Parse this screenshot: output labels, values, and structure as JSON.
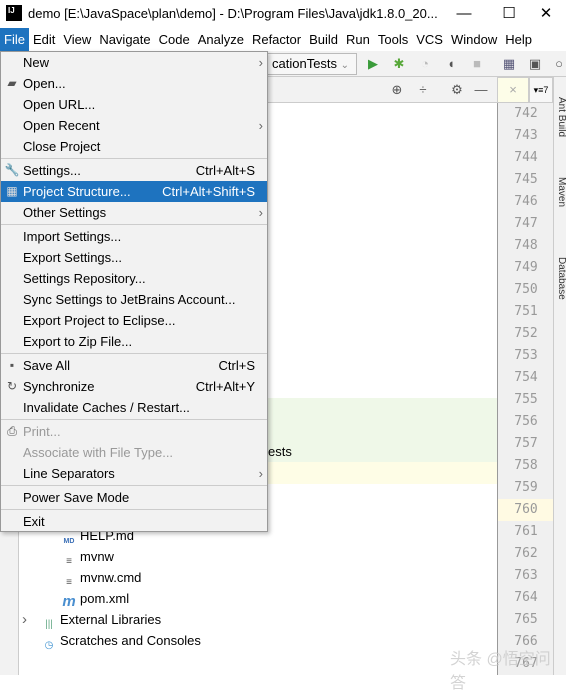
{
  "window": {
    "title": "demo [E:\\JavaSpace\\plan\\demo] - D:\\Program Files\\Java\\jdk1.8.0_20...",
    "logo": "IJ",
    "minimize": "—",
    "maximize": "☐",
    "close": "✕"
  },
  "menubar": [
    "File",
    "Edit",
    "View",
    "Navigate",
    "Code",
    "Analyze",
    "Refactor",
    "Build",
    "Run",
    "Tools",
    "VCS",
    "Window",
    "Help"
  ],
  "toolbar": {
    "run_config": "cationTests",
    "icons": [
      "run-icon",
      "debug-icon",
      "coverage-icon",
      "profile-icon",
      "stop-icon",
      "project-structure-icon",
      "terminal-icon"
    ]
  },
  "editor": {
    "tab_close": "×",
    "structure_tab": "▾≡7",
    "line_numbers": [
      "742",
      "743",
      "744",
      "745",
      "746",
      "747",
      "748",
      "749",
      "750",
      "751",
      "752",
      "753",
      "754",
      "755",
      "756",
      "757",
      "758",
      "759",
      "760",
      "761",
      "762",
      "763",
      "764",
      "765",
      "766",
      "767"
    ],
    "current_line": "760"
  },
  "right_tabs": [
    "Ant Build",
    "Maven",
    "Database"
  ],
  "tree": {
    "partial_text": "ests",
    "items": [
      {
        "label": "HELP.md",
        "icon": "markdown-file-icon"
      },
      {
        "label": "mvnw",
        "icon": "text-file-icon"
      },
      {
        "label": "mvnw.cmd",
        "icon": "text-file-icon"
      },
      {
        "label": "pom.xml",
        "icon": "maven-file-icon"
      },
      {
        "label": "External Libraries",
        "icon": "library-icon"
      },
      {
        "label": "Scratches and Consoles",
        "icon": "scratches-icon"
      }
    ]
  },
  "file_menu": [
    {
      "label": "New",
      "submenu": true
    },
    {
      "label": "Open...",
      "icon": "folder-icon"
    },
    {
      "label": "Open URL..."
    },
    {
      "label": "Open Recent",
      "submenu": true
    },
    {
      "label": "Close Project"
    },
    {
      "sep": true
    },
    {
      "label": "Settings...",
      "shortcut": "Ctrl+Alt+S",
      "icon": "wrench-icon"
    },
    {
      "label": "Project Structure...",
      "shortcut": "Ctrl+Alt+Shift+S",
      "icon": "project-structure-icon",
      "highlighted": true
    },
    {
      "label": "Other Settings",
      "submenu": true
    },
    {
      "sep": true
    },
    {
      "label": "Import Settings..."
    },
    {
      "label": "Export Settings..."
    },
    {
      "label": "Settings Repository..."
    },
    {
      "label": "Sync Settings to JetBrains Account..."
    },
    {
      "label": "Export Project to Eclipse..."
    },
    {
      "label": "Export to Zip File..."
    },
    {
      "sep": true
    },
    {
      "label": "Save All",
      "shortcut": "Ctrl+S",
      "icon": "save-icon"
    },
    {
      "label": "Synchronize",
      "shortcut": "Ctrl+Alt+Y",
      "icon": "sync-icon"
    },
    {
      "label": "Invalidate Caches / Restart..."
    },
    {
      "sep": true
    },
    {
      "label": "Print...",
      "disabled": true,
      "icon": "print-icon"
    },
    {
      "label": "Associate with File Type...",
      "disabled": true
    },
    {
      "label": "Line Separators",
      "submenu": true
    },
    {
      "sep": true
    },
    {
      "label": "Power Save Mode"
    },
    {
      "sep": true
    },
    {
      "label": "Exit"
    }
  ],
  "watermark": "头条 @悟空问答",
  "colors": {
    "highlight": "#1e73bf",
    "menu_bg": "#f2f2f2",
    "green_row": "#eff8e8",
    "current_line": "#fffae3"
  }
}
